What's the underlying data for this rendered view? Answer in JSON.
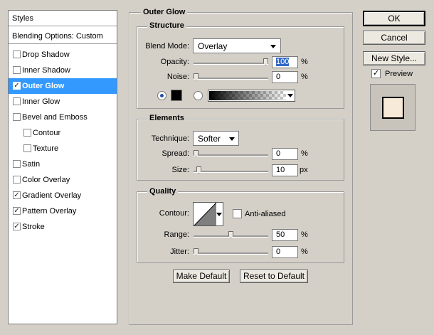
{
  "sidebar": {
    "header": "Styles",
    "blending": "Blending Options: Custom",
    "items": [
      {
        "label": "Drop Shadow",
        "checked": false
      },
      {
        "label": "Inner Shadow",
        "checked": false
      },
      {
        "label": "Outer Glow",
        "checked": true
      },
      {
        "label": "Inner Glow",
        "checked": false
      },
      {
        "label": "Bevel and Emboss",
        "checked": false
      },
      {
        "label": "Contour",
        "checked": false
      },
      {
        "label": "Texture",
        "checked": false
      },
      {
        "label": "Satin",
        "checked": false
      },
      {
        "label": "Color Overlay",
        "checked": false
      },
      {
        "label": "Gradient Overlay",
        "checked": true
      },
      {
        "label": "Pattern Overlay",
        "checked": true
      },
      {
        "label": "Stroke",
        "checked": true
      }
    ]
  },
  "panel": {
    "title": "Outer Glow",
    "structure": {
      "title": "Structure",
      "blend_mode_label": "Blend Mode:",
      "blend_mode_value": "Overlay",
      "opacity_label": "Opacity:",
      "opacity_value": "100",
      "opacity_level": 1.0,
      "noise_label": "Noise:",
      "noise_value": "0",
      "noise_level": 0.0,
      "unit": "%",
      "color": "#000000"
    },
    "elements": {
      "title": "Elements",
      "technique_label": "Technique:",
      "technique_value": "Softer",
      "spread_label": "Spread:",
      "spread_value": "0",
      "spread_level": 0.0,
      "spread_unit": "%",
      "size_label": "Size:",
      "size_value": "10",
      "size_level": 0.04,
      "size_unit": "px"
    },
    "quality": {
      "title": "Quality",
      "contour_label": "Contour:",
      "anti_aliased_label": "Anti-aliased",
      "anti_aliased": false,
      "range_label": "Range:",
      "range_value": "50",
      "range_level": 0.5,
      "range_unit": "%",
      "jitter_label": "Jitter:",
      "jitter_value": "0",
      "jitter_level": 0.0,
      "jitter_unit": "%"
    },
    "make_default": "Make Default",
    "reset_default": "Reset to Default"
  },
  "buttons": {
    "ok": "OK",
    "cancel": "Cancel",
    "new_style": "New Style...",
    "preview_label": "Preview",
    "preview_checked": true,
    "preview_swatch": "#f8ead8"
  }
}
